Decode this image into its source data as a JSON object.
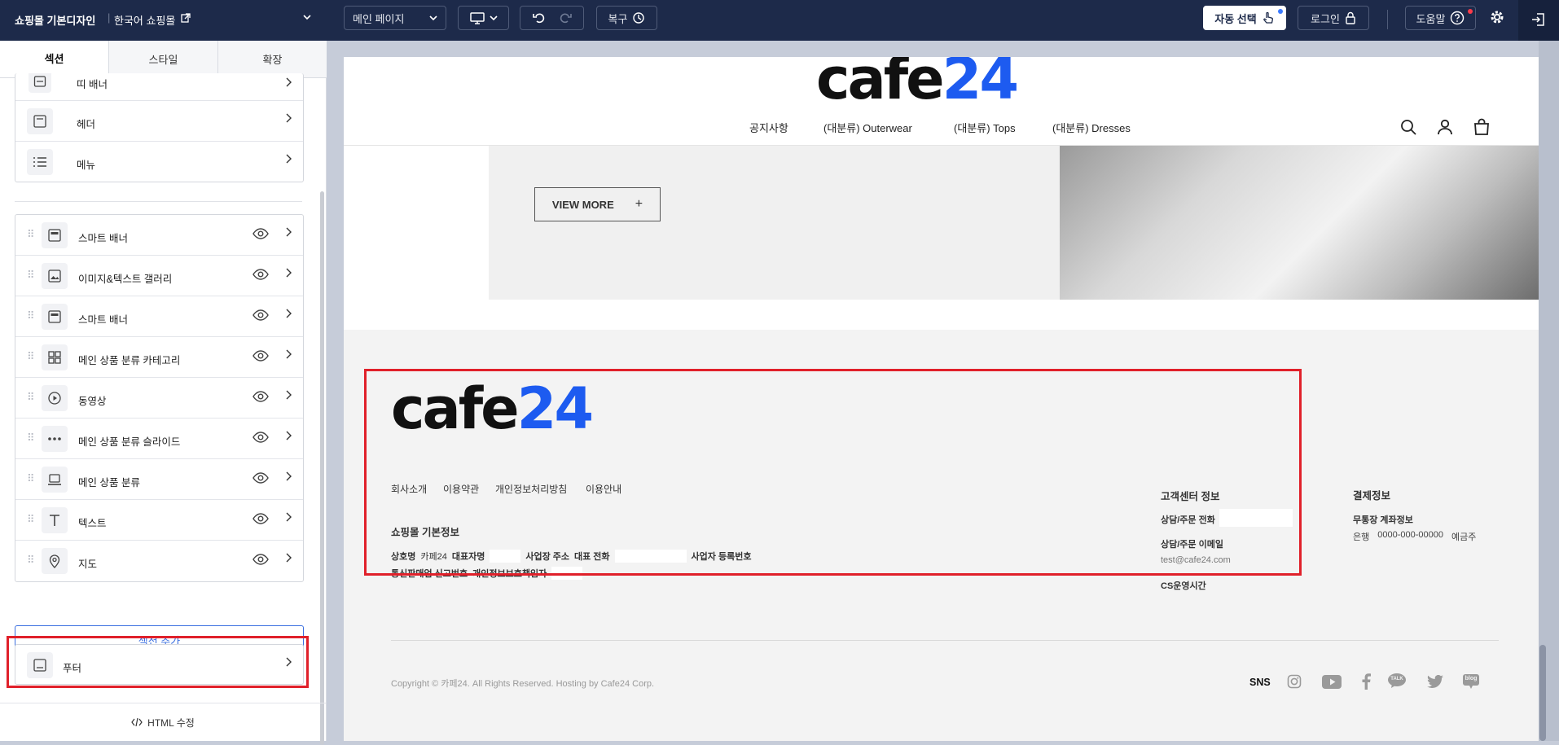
{
  "topbar": {
    "site_name": "쇼핑몰 기본디자인",
    "shop_name": "한국어 쇼핑몰",
    "page_select": "메인 페이지",
    "restore_label": "복구",
    "auto_select_label": "자동 선택",
    "login_label": "로그인",
    "help_label": "도움말"
  },
  "sidebar": {
    "tabs": [
      "섹션",
      "스타일",
      "확장"
    ],
    "top_items": [
      "띠 배너",
      "헤더",
      "메뉴"
    ],
    "sections": [
      {
        "label": "스마트 배너",
        "icon": "banner-icon"
      },
      {
        "label": "이미지&텍스트 갤러리",
        "icon": "image-icon"
      },
      {
        "label": "스마트 배너",
        "icon": "banner-icon"
      },
      {
        "label": "메인 상품 분류 카테고리",
        "icon": "grid-icon"
      },
      {
        "label": "동영상",
        "icon": "play-icon"
      },
      {
        "label": "메인 상품 분류 슬라이드",
        "icon": "dots-icon"
      },
      {
        "label": "메인 상품 분류",
        "icon": "laptop-icon"
      },
      {
        "label": "텍스트",
        "icon": "text-icon"
      },
      {
        "label": "지도",
        "icon": "map-pin-icon"
      }
    ],
    "add_section_label": "섹션 추가",
    "footer_item": "푸터",
    "html_edit_label": "HTML 수정"
  },
  "preview": {
    "logo_black": "cafe",
    "logo_blue": "24",
    "nav": [
      "공지사항",
      "(대분류) Outerwear",
      "(대분류) Tops",
      "(대분류) Dresses"
    ],
    "hero_button": "VIEW MORE",
    "footer": {
      "links": [
        "회사소개",
        "이용약관",
        "개인정보처리방침",
        "이용안내"
      ],
      "basic_info_title": "쇼핑몰 기본정보",
      "line1": {
        "company_label": "상호명",
        "company_value": "카페24",
        "ceo_label": "대표자명",
        "address_label": "사업장 주소",
        "phone_label": "대표 전화",
        "bizno_label": "사업자 등록번호"
      },
      "line2": {
        "mailorder_label": "통신판매업 신고번호",
        "privacy_label": "개인정보보호책임자"
      },
      "cs_title": "고객센터 정보",
      "cs_phone_label": "상담/주문 전화",
      "cs_email_label": "상담/주문 이메일",
      "cs_email": "test@cafe24.com",
      "cs_hours_label": "CS운영시간",
      "pay_title": "결제정보",
      "pay_sub": "무통장 계좌정보",
      "bank_label": "은행",
      "account": "0000-000-00000",
      "holder_label": "예금주",
      "copyright": "Copyright © 카페24. All Rights Reserved. Hosting by Cafe24 Corp.",
      "sns_label": "SNS",
      "sns_talk": "TALK",
      "sns_blog": "blog"
    }
  },
  "colors": {
    "topbar": "#1d2a4a",
    "accent_blue": "#1d5bf0",
    "highlight_red": "#e0202a"
  }
}
